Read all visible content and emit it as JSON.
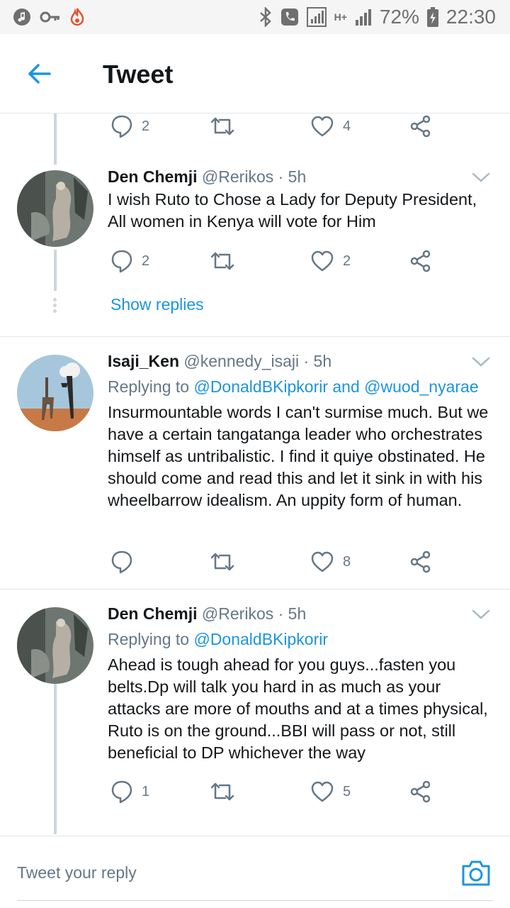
{
  "status_bar": {
    "battery_text": "72%",
    "time": "22:30",
    "network_label": "H+"
  },
  "app_bar": {
    "title": "Tweet",
    "back_icon": "back-arrow-icon"
  },
  "colors": {
    "accent": "#1b95e0",
    "muted": "#657786",
    "text": "#14171a",
    "divider": "#e1e8ed"
  },
  "top_actions": {
    "replies": "2",
    "retweets": "",
    "likes": "4"
  },
  "tweets": [
    {
      "name": "Den Chemji",
      "handle": "@Rerikos",
      "time": "· 5h",
      "reply_prefix": "",
      "reply_to": "",
      "text": "I wish Ruto to Chose a Lady for Deputy  President, All women in Kenya will vote for Him",
      "replies": "2",
      "retweets": "",
      "likes": "2"
    },
    {
      "name": "Isaji_Ken",
      "handle": "@kennedy_isaji",
      "time": "· 5h",
      "reply_prefix": "Replying to",
      "reply_to": "@DonaldBKipkorir and @wuod_nyarae",
      "text": "Insurmountable words I can't surmise much.  But we have a certain tangatanga leader who orchestrates himself as untribalistic. I find it quiye obstinated. He should come and read this and let it sink in with his wheelbarrow idealism. An uppity form of human.",
      "replies": "",
      "retweets": "",
      "likes": "8"
    },
    {
      "name": "Den Chemji",
      "handle": "@Rerikos",
      "time": "· 5h",
      "reply_prefix": "Replying to",
      "reply_to": "@DonaldBKipkorir",
      "text": "Ahead is tough ahead for you guys...fasten you belts.Dp will talk you hard in as much as your attacks are more of mouths and at a times physical, Ruto is on the ground...BBI will pass or not, still beneficial to DP whichever the way",
      "replies": "1",
      "retweets": "",
      "likes": "5"
    }
  ],
  "show_replies": "Show replies",
  "reply_bar": {
    "placeholder": "Tweet your reply"
  }
}
